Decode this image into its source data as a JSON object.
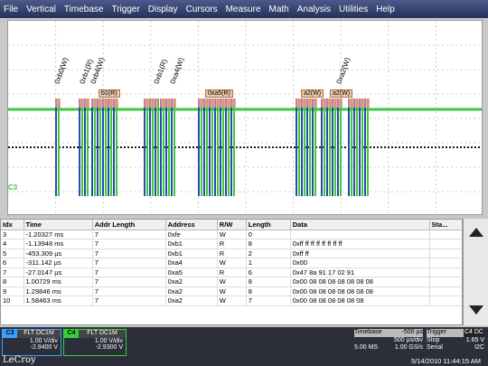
{
  "menu": [
    "File",
    "Vertical",
    "Timebase",
    "Trigger",
    "Display",
    "Cursors",
    "Measure",
    "Math",
    "Analysis",
    "Utilities",
    "Help"
  ],
  "scope": {
    "ground_marker": "C3",
    "rotated_tags": [
      "0xb0(W)",
      "0xb1(R)",
      "0xb4(W)",
      "0xb1(R)",
      "0xa4(W)",
      "0xa2(W)"
    ],
    "flat_labels": [
      "b1(R)",
      "0xa5(R)",
      "a2(W)",
      "a2(W)"
    ],
    "colors": {
      "trace_green": "#3cc93c",
      "bus_blue": "#2c4aa8",
      "highlight": "#e89090"
    }
  },
  "table": {
    "headers": [
      "Idx",
      "Time",
      "Addr Length",
      "Address",
      "R/W",
      "Length",
      "Data",
      "Sta..."
    ],
    "rows": [
      [
        "3",
        "-1.20327 ms",
        "7",
        "0xfe",
        "W",
        "0",
        ""
      ],
      [
        "4",
        "-1.13948 ms",
        "7",
        "0xb1",
        "R",
        "8",
        "0xff ff ff ff ff ff ff ff"
      ],
      [
        "5",
        "-453.309 µs",
        "7",
        "0xb1",
        "R",
        "2",
        "0xff ff"
      ],
      [
        "6",
        "-311.142 µs",
        "7",
        "0xa4",
        "W",
        "1",
        "0x00"
      ],
      [
        "7",
        "-27.0147 µs",
        "7",
        "0xa5",
        "R",
        "6",
        "0x47 8a 91 17 02 91"
      ],
      [
        "8",
        "1.00729 ms",
        "7",
        "0xa2",
        "W",
        "8",
        "0x00 08 08 08 08 08 08 08"
      ],
      [
        "9",
        "1.29846 ms",
        "7",
        "0xa2",
        "W",
        "8",
        "0x00 08 08 08 08 08 08 08"
      ],
      [
        "10",
        "1.58463 ms",
        "7",
        "0xa2",
        "W",
        "7",
        "0x00 08 08 08 08 08 08"
      ]
    ]
  },
  "channels": [
    {
      "num": "C3",
      "flags": "FLT DC1M",
      "vdiv": "1.00 V/div",
      "offset": "-2.9400 V",
      "color": "#3aa0ff"
    },
    {
      "num": "C4",
      "flags": "FLT DC1M",
      "vdiv": "1.00 V/div",
      "offset": "-2.9300 V",
      "color": "#35d035"
    }
  ],
  "timebase": {
    "label": "Timebase",
    "delay": "-500 µs",
    "tdiv": "500 µs/div",
    "samples": "5.00 MS",
    "rate": "1.00 GS/s"
  },
  "trigger": {
    "label": "Trigger",
    "flag": "C4 DC",
    "mode": "Stop",
    "level": "1.65 V",
    "type": "Serial",
    "proto": "I2C"
  },
  "brand": "LeCroy",
  "datetime": "5/14/2010 11:44:15 AM"
}
